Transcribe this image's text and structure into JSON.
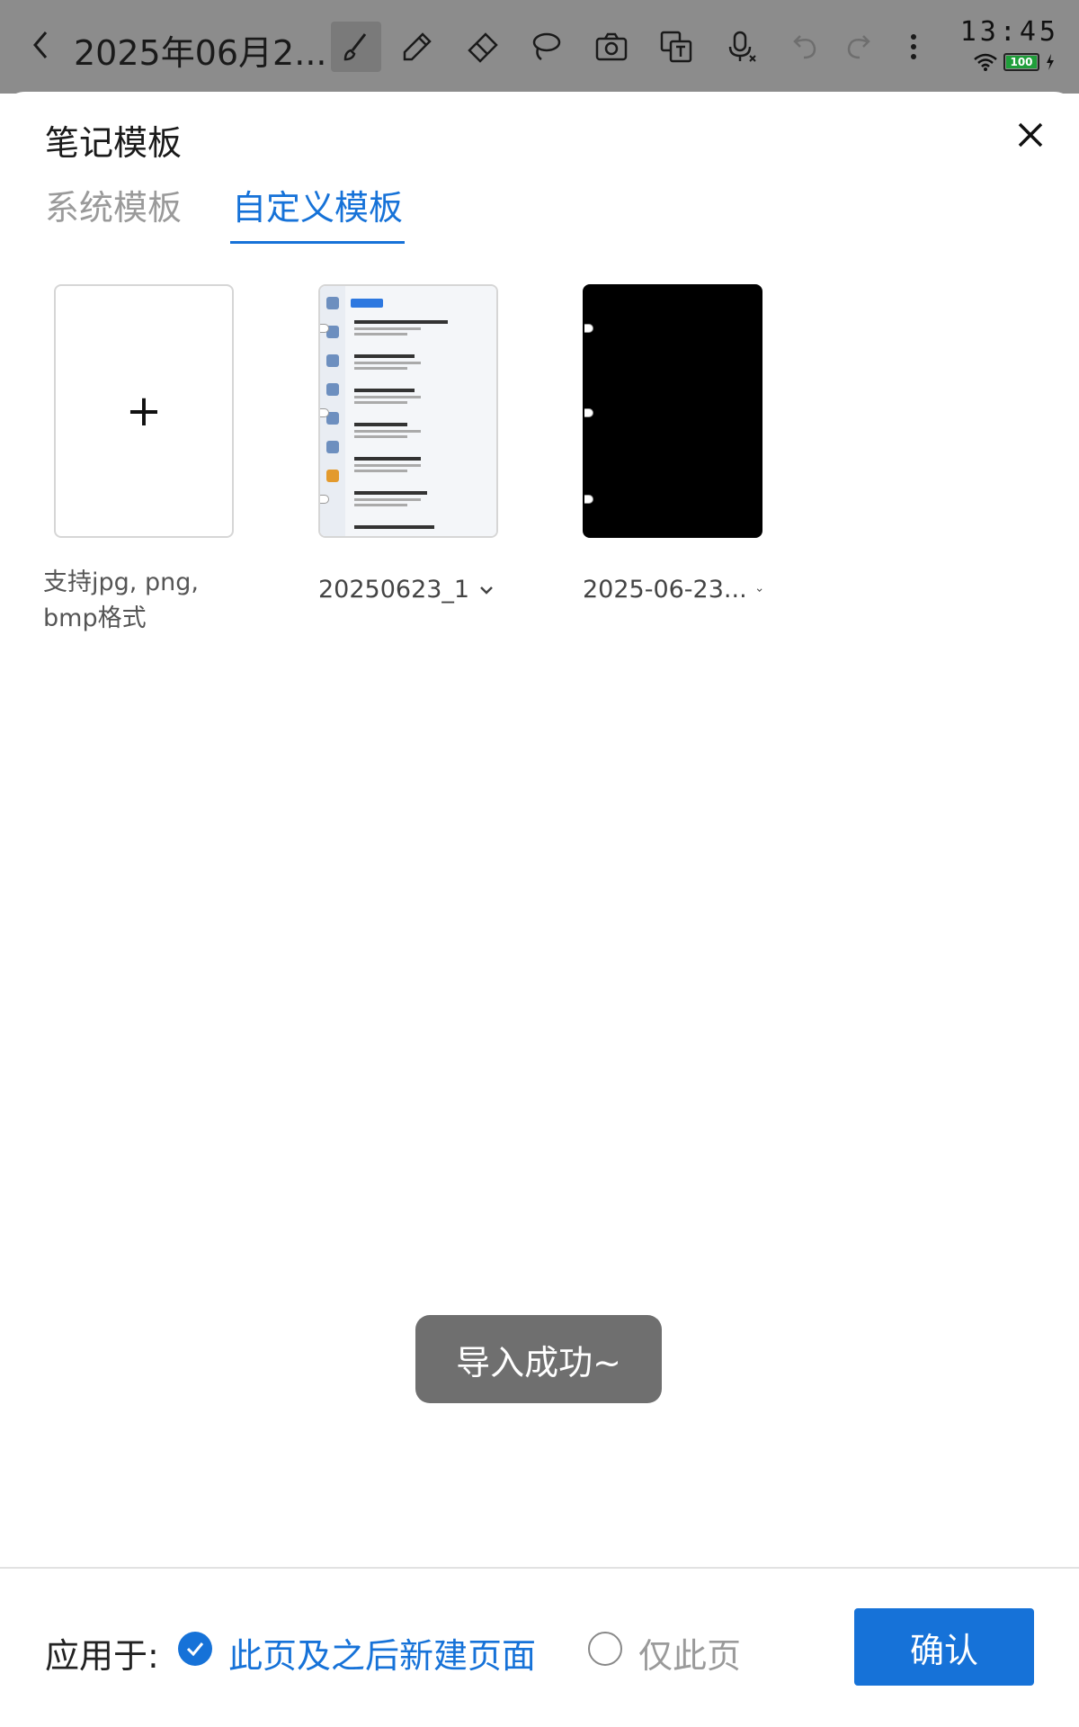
{
  "topbar": {
    "title": "2025年06月2...",
    "time": "13:45",
    "battery": "100",
    "tools": [
      "brush-icon",
      "pen-icon",
      "eraser-icon",
      "lasso-icon",
      "camera-icon",
      "translate-icon",
      "mic-icon",
      "undo-icon",
      "redo-icon",
      "more-icon"
    ]
  },
  "sheet": {
    "title": "笔记模板",
    "tabs": [
      {
        "label": "系统模板",
        "active": false
      },
      {
        "label": "自定义模板",
        "active": true
      }
    ]
  },
  "templates": {
    "add_hint": "支持jpg, png, bmp格式",
    "items": [
      {
        "name": "20250623_1"
      },
      {
        "name": "2025-06-23..."
      }
    ]
  },
  "toast": {
    "text": "导入成功~"
  },
  "apply": {
    "label": "应用于:",
    "option_all": "此页及之后新建页面",
    "option_this": "仅此页",
    "selected": "option_all",
    "confirm_label": "确认"
  },
  "colors": {
    "accent": "#1672d8",
    "toast_bg": "#6f6f6f"
  }
}
